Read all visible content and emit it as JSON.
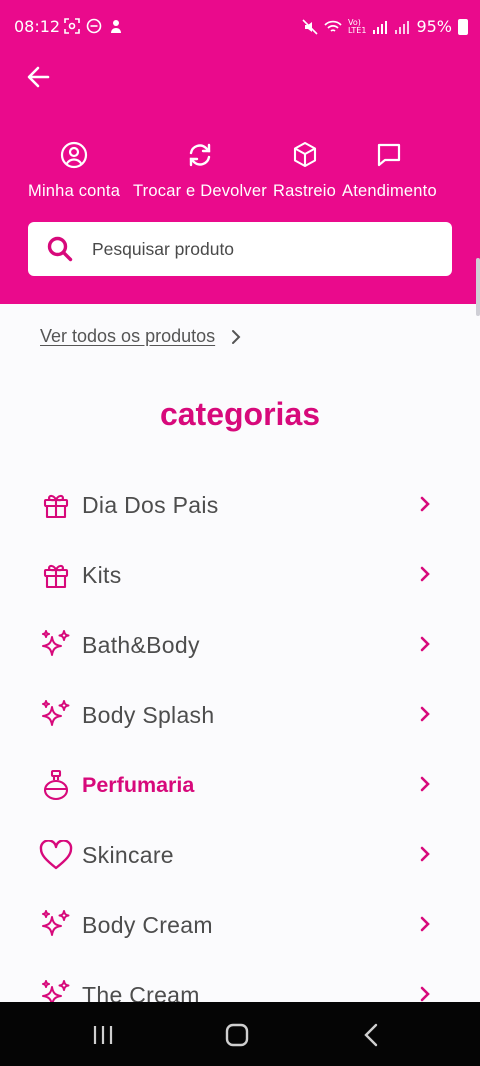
{
  "status": {
    "time": "08:12",
    "battery": "95%"
  },
  "quick_actions": [
    {
      "label": "Minha conta",
      "icon": "user-circle-icon"
    },
    {
      "label": "Trocar e Devolver",
      "icon": "refresh-icon"
    },
    {
      "label": "Rastreio",
      "icon": "box-icon"
    },
    {
      "label": "Atendimento",
      "icon": "chat-icon"
    }
  ],
  "search": {
    "placeholder": "Pesquisar produto"
  },
  "see_all": "Ver todos os produtos",
  "categories_title": "categorias",
  "categories": [
    {
      "label": "Dia Dos Pais",
      "icon": "gift-icon"
    },
    {
      "label": "Kits",
      "icon": "gift-icon"
    },
    {
      "label": "Bath&Body",
      "icon": "sparkles-icon"
    },
    {
      "label": "Body Splash",
      "icon": "sparkles-icon"
    },
    {
      "label": "Perfumaria",
      "icon": "perfume-icon",
      "active": true
    },
    {
      "label": "Skincare",
      "icon": "heart-icon"
    },
    {
      "label": "Body Cream",
      "icon": "sparkles-icon"
    },
    {
      "label": "The Cream",
      "icon": "sparkles-icon"
    }
  ],
  "colors": {
    "brand": "#ea0a8c",
    "accent": "#d7097b"
  }
}
